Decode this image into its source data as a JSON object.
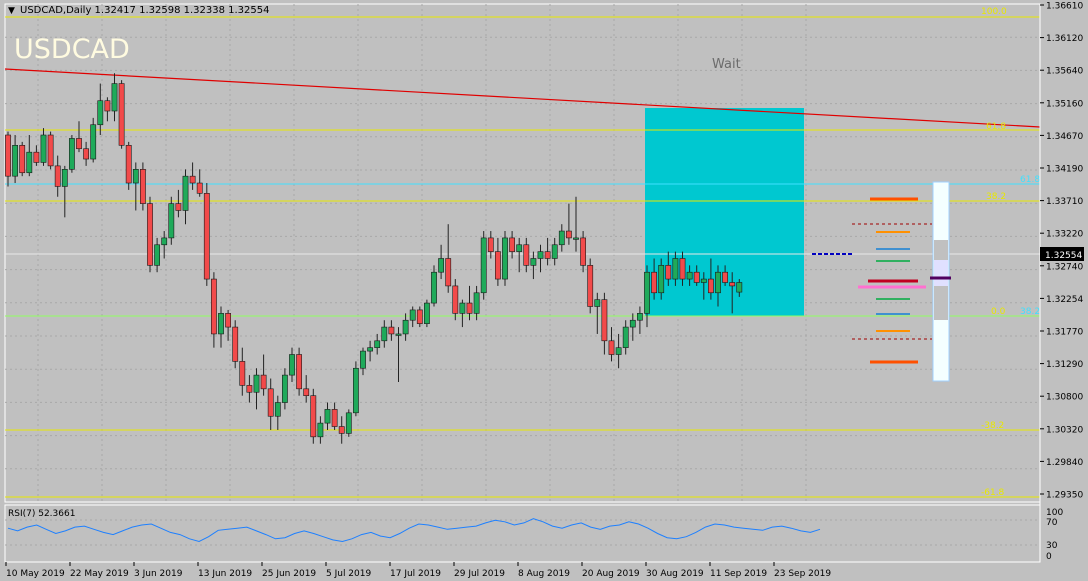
{
  "header": {
    "menu_glyph": "▼",
    "symbol_info": "USDCAD,Daily  1.32417  1.32598  1.32338  1.32554"
  },
  "watermark": "USDCAD",
  "status_text": "Wait",
  "price_axis": {
    "ticks": [
      "1.36610",
      "1.36120",
      "1.35640",
      "1.35160",
      "1.34670",
      "1.34190",
      "1.33710",
      "1.33220",
      "1.32740",
      "1.32254",
      "1.31770",
      "1.31290",
      "1.30800",
      "1.30320",
      "1.29840",
      "1.29350"
    ],
    "current_price": "1.32554"
  },
  "fib_labels": {
    "f100": "100.0",
    "f618": "61.8",
    "f382": "38.2",
    "f0": "0.0",
    "fm382": "-38.2",
    "fm618": "-61.8",
    "cyan_top": "61.8",
    "cyan_bottom": "38.2"
  },
  "rsi": {
    "title": "RSI(7) 52.3661",
    "ticks": [
      "100",
      "70",
      "30",
      "0"
    ],
    "values": [
      60,
      55,
      62,
      66,
      58,
      50,
      55,
      62,
      64,
      58,
      52,
      48,
      55,
      62,
      66,
      68,
      60,
      52,
      48,
      40,
      35,
      44,
      56,
      58,
      60,
      62,
      55,
      48,
      40,
      42,
      50,
      55,
      50,
      44,
      38,
      35,
      40,
      48,
      52,
      45,
      42,
      50,
      60,
      68,
      66,
      62,
      58,
      60,
      62,
      64,
      70,
      75,
      72,
      66,
      70,
      78,
      72,
      64,
      60,
      66,
      70,
      62,
      58,
      64,
      66,
      72,
      68,
      60,
      50,
      42,
      40,
      44,
      52,
      62,
      68,
      66,
      62,
      60,
      58,
      56,
      62,
      64,
      60,
      55,
      52,
      58
    ]
  },
  "time_axis": [
    "10 May 2019",
    "22 May 2019",
    "3 Jun 2019",
    "13 Jun 2019",
    "25 Jun 2019",
    "5 Jul 2019",
    "17 Jul 2019",
    "29 Jul 2019",
    "8 Aug 2019",
    "20 Aug 2019",
    "30 Aug 2019",
    "11 Sep 2019",
    "23 Sep 2019"
  ],
  "chart_data": {
    "type": "candlestick",
    "symbol": "USDCAD",
    "timeframe": "Daily",
    "ylim": [
      1.2935,
      1.3661
    ],
    "ohlc": [
      [
        1.347,
        1.3475,
        1.3395,
        1.341
      ],
      [
        1.341,
        1.347,
        1.34,
        1.3455
      ],
      [
        1.3455,
        1.346,
        1.341,
        1.3415
      ],
      [
        1.3415,
        1.347,
        1.341,
        1.3445
      ],
      [
        1.3445,
        1.3455,
        1.3425,
        1.343
      ],
      [
        1.343,
        1.348,
        1.3425,
        1.347
      ],
      [
        1.347,
        1.3475,
        1.342,
        1.3425
      ],
      [
        1.3425,
        1.344,
        1.338,
        1.3395
      ],
      [
        1.3395,
        1.3425,
        1.335,
        1.342
      ],
      [
        1.342,
        1.347,
        1.3415,
        1.3465
      ],
      [
        1.3465,
        1.349,
        1.3445,
        1.345
      ],
      [
        1.345,
        1.346,
        1.3425,
        1.3435
      ],
      [
        1.3435,
        1.3495,
        1.343,
        1.3485
      ],
      [
        1.3485,
        1.3545,
        1.347,
        1.352
      ],
      [
        1.352,
        1.3525,
        1.349,
        1.3505
      ],
      [
        1.3505,
        1.356,
        1.349,
        1.3545
      ],
      [
        1.3545,
        1.355,
        1.345,
        1.3455
      ],
      [
        1.3455,
        1.346,
        1.339,
        1.34
      ],
      [
        1.34,
        1.343,
        1.336,
        1.342
      ],
      [
        1.342,
        1.343,
        1.336,
        1.337
      ],
      [
        1.337,
        1.338,
        1.327,
        1.328
      ],
      [
        1.328,
        1.332,
        1.327,
        1.331
      ],
      [
        1.331,
        1.333,
        1.329,
        1.332
      ],
      [
        1.332,
        1.338,
        1.331,
        1.337
      ],
      [
        1.337,
        1.339,
        1.335,
        1.336
      ],
      [
        1.336,
        1.342,
        1.334,
        1.341
      ],
      [
        1.341,
        1.343,
        1.339,
        1.34
      ],
      [
        1.34,
        1.342,
        1.338,
        1.3385
      ],
      [
        1.3385,
        1.34,
        1.325,
        1.326
      ],
      [
        1.326,
        1.327,
        1.316,
        1.318
      ],
      [
        1.318,
        1.322,
        1.316,
        1.321
      ],
      [
        1.321,
        1.3215,
        1.317,
        1.319
      ],
      [
        1.319,
        1.32,
        1.313,
        1.314
      ],
      [
        1.314,
        1.316,
        1.309,
        1.3105
      ],
      [
        1.3105,
        1.312,
        1.308,
        1.3095
      ],
      [
        1.3095,
        1.313,
        1.307,
        1.312
      ],
      [
        1.312,
        1.315,
        1.309,
        1.31
      ],
      [
        1.31,
        1.3115,
        1.304,
        1.306
      ],
      [
        1.306,
        1.309,
        1.304,
        1.308
      ],
      [
        1.308,
        1.313,
        1.307,
        1.312
      ],
      [
        1.312,
        1.316,
        1.311,
        1.315
      ],
      [
        1.315,
        1.316,
        1.309,
        1.31
      ],
      [
        1.31,
        1.312,
        1.308,
        1.309
      ],
      [
        1.309,
        1.31,
        1.302,
        1.303
      ],
      [
        1.303,
        1.306,
        1.302,
        1.305
      ],
      [
        1.305,
        1.308,
        1.304,
        1.307
      ],
      [
        1.307,
        1.308,
        1.304,
        1.3045
      ],
      [
        1.3045,
        1.306,
        1.302,
        1.3035
      ],
      [
        1.3035,
        1.307,
        1.303,
        1.3065
      ],
      [
        1.3065,
        1.314,
        1.306,
        1.313
      ],
      [
        1.313,
        1.316,
        1.312,
        1.3155
      ],
      [
        1.3155,
        1.317,
        1.314,
        1.316
      ],
      [
        1.316,
        1.318,
        1.315,
        1.317
      ],
      [
        1.317,
        1.32,
        1.316,
        1.319
      ],
      [
        1.319,
        1.32,
        1.317,
        1.318
      ],
      [
        1.318,
        1.319,
        1.311,
        1.318
      ],
      [
        1.318,
        1.321,
        1.317,
        1.32
      ],
      [
        1.32,
        1.322,
        1.319,
        1.3215
      ],
      [
        1.3215,
        1.322,
        1.319,
        1.3195
      ],
      [
        1.3195,
        1.323,
        1.319,
        1.3225
      ],
      [
        1.3225,
        1.328,
        1.322,
        1.327
      ],
      [
        1.327,
        1.331,
        1.326,
        1.329
      ],
      [
        1.329,
        1.334,
        1.324,
        1.325
      ],
      [
        1.325,
        1.326,
        1.32,
        1.321
      ],
      [
        1.321,
        1.323,
        1.319,
        1.3225
      ],
      [
        1.3225,
        1.325,
        1.32,
        1.321
      ],
      [
        1.321,
        1.325,
        1.32,
        1.324
      ],
      [
        1.324,
        1.333,
        1.323,
        1.332
      ],
      [
        1.332,
        1.333,
        1.329,
        1.33
      ],
      [
        1.33,
        1.332,
        1.325,
        1.326
      ],
      [
        1.326,
        1.333,
        1.325,
        1.332
      ],
      [
        1.332,
        1.333,
        1.329,
        1.33
      ],
      [
        1.33,
        1.332,
        1.327,
        1.331
      ],
      [
        1.331,
        1.332,
        1.327,
        1.328
      ],
      [
        1.328,
        1.33,
        1.326,
        1.329
      ],
      [
        1.329,
        1.331,
        1.327,
        1.33
      ],
      [
        1.33,
        1.332,
        1.328,
        1.329
      ],
      [
        1.329,
        1.332,
        1.328,
        1.331
      ],
      [
        1.331,
        1.334,
        1.33,
        1.333
      ],
      [
        1.333,
        1.337,
        1.331,
        1.332
      ],
      [
        1.332,
        1.338,
        1.33,
        1.332
      ],
      [
        1.332,
        1.333,
        1.327,
        1.328
      ],
      [
        1.328,
        1.329,
        1.321,
        1.322
      ],
      [
        1.322,
        1.324,
        1.318,
        1.323
      ],
      [
        1.323,
        1.324,
        1.315,
        1.317
      ],
      [
        1.317,
        1.319,
        1.314,
        1.315
      ],
      [
        1.315,
        1.318,
        1.313,
        1.316
      ],
      [
        1.316,
        1.32,
        1.315,
        1.319
      ],
      [
        1.319,
        1.321,
        1.317,
        1.32
      ],
      [
        1.32,
        1.322,
        1.318,
        1.321
      ],
      [
        1.321,
        1.328,
        1.319,
        1.327
      ],
      [
        1.327,
        1.329,
        1.323,
        1.324
      ],
      [
        1.324,
        1.329,
        1.323,
        1.328
      ],
      [
        1.328,
        1.33,
        1.325,
        1.326
      ],
      [
        1.326,
        1.33,
        1.325,
        1.329
      ],
      [
        1.329,
        1.33,
        1.325,
        1.326
      ],
      [
        1.326,
        1.328,
        1.325,
        1.327
      ],
      [
        1.327,
        1.328,
        1.325,
        1.3255
      ],
      [
        1.3255,
        1.327,
        1.323,
        1.326
      ],
      [
        1.326,
        1.329,
        1.323,
        1.324
      ],
      [
        1.324,
        1.328,
        1.322,
        1.327
      ],
      [
        1.327,
        1.328,
        1.325,
        1.3255
      ],
      [
        1.3255,
        1.327,
        1.321,
        1.325
      ],
      [
        1.3241,
        1.326,
        1.3234,
        1.3255
      ]
    ]
  }
}
